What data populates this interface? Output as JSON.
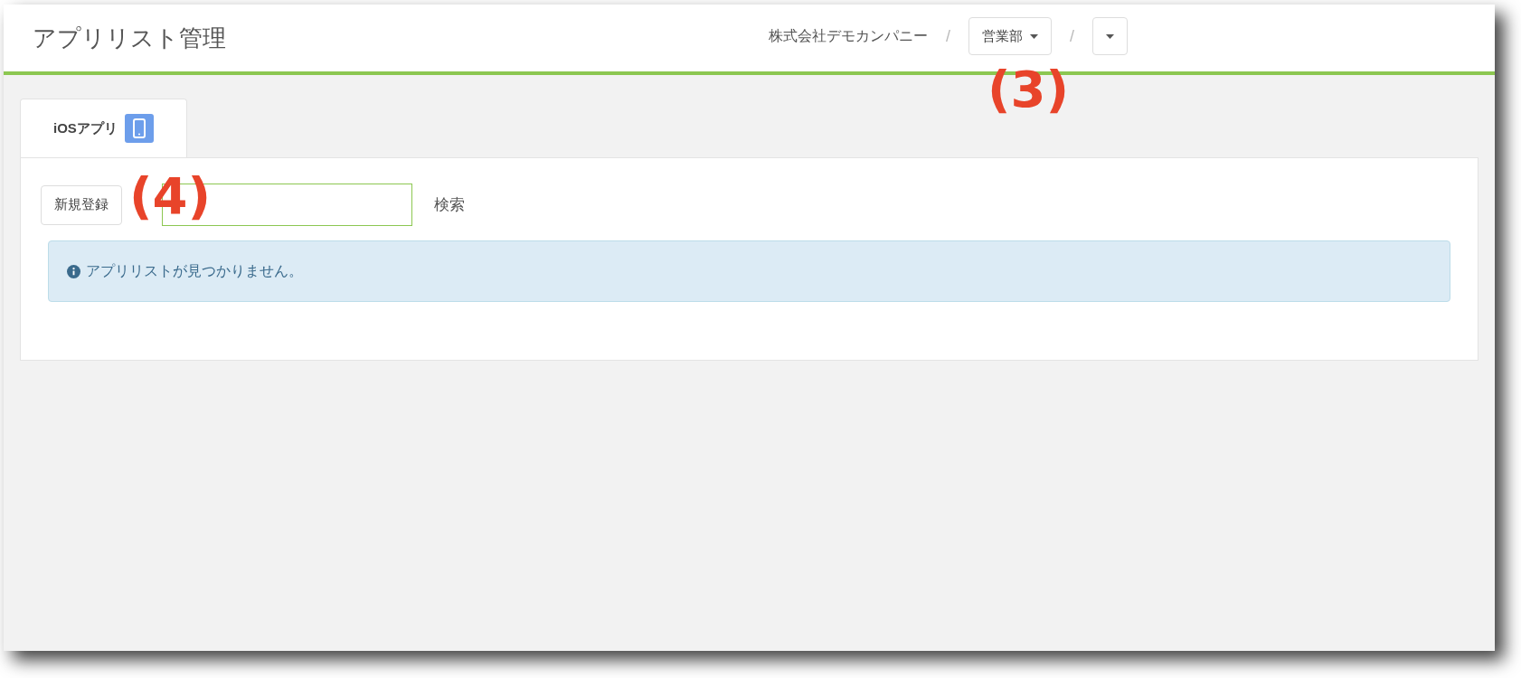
{
  "header": {
    "title": "アプリリスト管理",
    "breadcrumb": [
      {
        "kind": "text",
        "label": "株式会社デモカンパニー"
      },
      {
        "kind": "separator",
        "label": "/"
      },
      {
        "kind": "dropdown",
        "label": "営業部"
      },
      {
        "kind": "separator",
        "label": "/"
      },
      {
        "kind": "dropdown"
      }
    ],
    "annotation": "(3)"
  },
  "tabs": [
    {
      "label": "iOSアプリ",
      "selected": true
    }
  ],
  "toolbar": {
    "new_button": "新規登録",
    "search_button": "検索",
    "annotation": "(4)"
  },
  "alert": {
    "message": "アプリリストが見つかりません。"
  }
}
